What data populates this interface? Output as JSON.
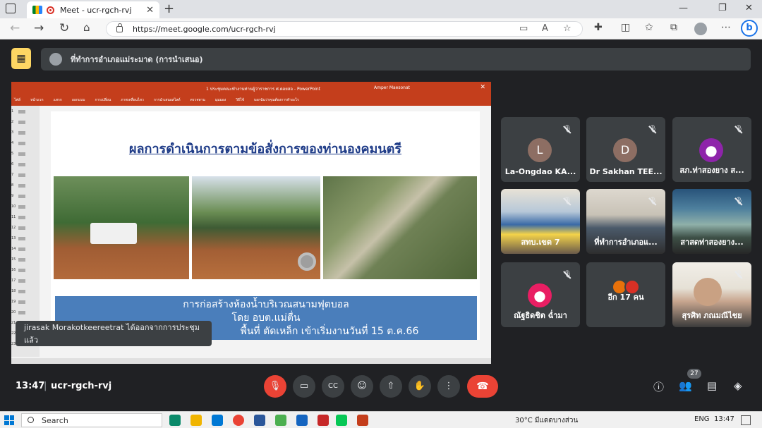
{
  "browser": {
    "tab_title": "Meet - ucr-rgch-rvj",
    "tab_close": "✕",
    "new_tab": "+",
    "url": "https://meet.google.com/ucr-rgch-rvj"
  },
  "meet": {
    "presenter_label": "ที่ทำการอำเภอแม่ระมาด (การนำเสนอ)",
    "meeting_time": "13:47",
    "meeting_code": "ucr-rgch-rvj",
    "participant_count": "27",
    "toast": "jirasak Morakotkeereetrat ได้ออกจากการประชุมแล้ว"
  },
  "presentation": {
    "window_title": "1 ประชุมคณะทำงานท่านผู้ว่าราชการ ศ.ดอยสอ - PowerPoint",
    "user": "Amper Maesonat",
    "ribbon": [
      "ไฟล์",
      "หน้าแรก",
      "แทรก",
      "ออกแบบ",
      "การเปลี่ยน",
      "ภาพเคลื่อนไหว",
      "การนำเสนอสไลด์",
      "ตรวจทาน",
      "มุมมอง",
      "วิธีใช้",
      "บอกฉันว่าคุณต้องการทำอะไร"
    ],
    "slide_title": "ผลการดำเนินการตามข้อสั่งการของท่านองคมนตรี",
    "banner_line1": "การก่อสร้างห้องน้ำบริเวณสนามฟุตบอล",
    "banner_line2": "โดย อบต.แม่ตื่น",
    "banner_line3": "พื้นที่ ตัดเหล็ก เข้าเริ่มงานวันที่ 15 ต.ค.66"
  },
  "tiles": [
    {
      "name": "La-Ongdao KA...",
      "initial": "L",
      "color": "#8d6e63"
    },
    {
      "name": "Dr Sakhan TEE...",
      "initial": "D",
      "color": "#8d6e63"
    },
    {
      "name": "สภ.ท่าสองยาง ส...",
      "initial": "",
      "color": "#8e24aa"
    },
    {
      "name": "สทบ.เขต 7"
    },
    {
      "name": "ที่ทำการอำเภอแ..."
    },
    {
      "name": "สาสดท่าสองยาง..."
    },
    {
      "name": "ณัฐธิดชิต ฉ่ำมา",
      "initial": "",
      "color": "#e91e63"
    },
    {
      "name": "อีก 17 คน"
    },
    {
      "name": "สุรศิท ภณมณีไชย"
    }
  ],
  "taskbar": {
    "search": "Search",
    "weather": "30°C มีแดดบางส่วน",
    "lang": "ENG",
    "time": "13:47"
  },
  "colors": {
    "meet_bg": "#202124",
    "tile_bg": "#3c4043",
    "hangup": "#ea4335",
    "presenting": "#fdd663",
    "ppt_ribbon": "#c43e1c",
    "slide_banner": "#4a7ebb"
  }
}
